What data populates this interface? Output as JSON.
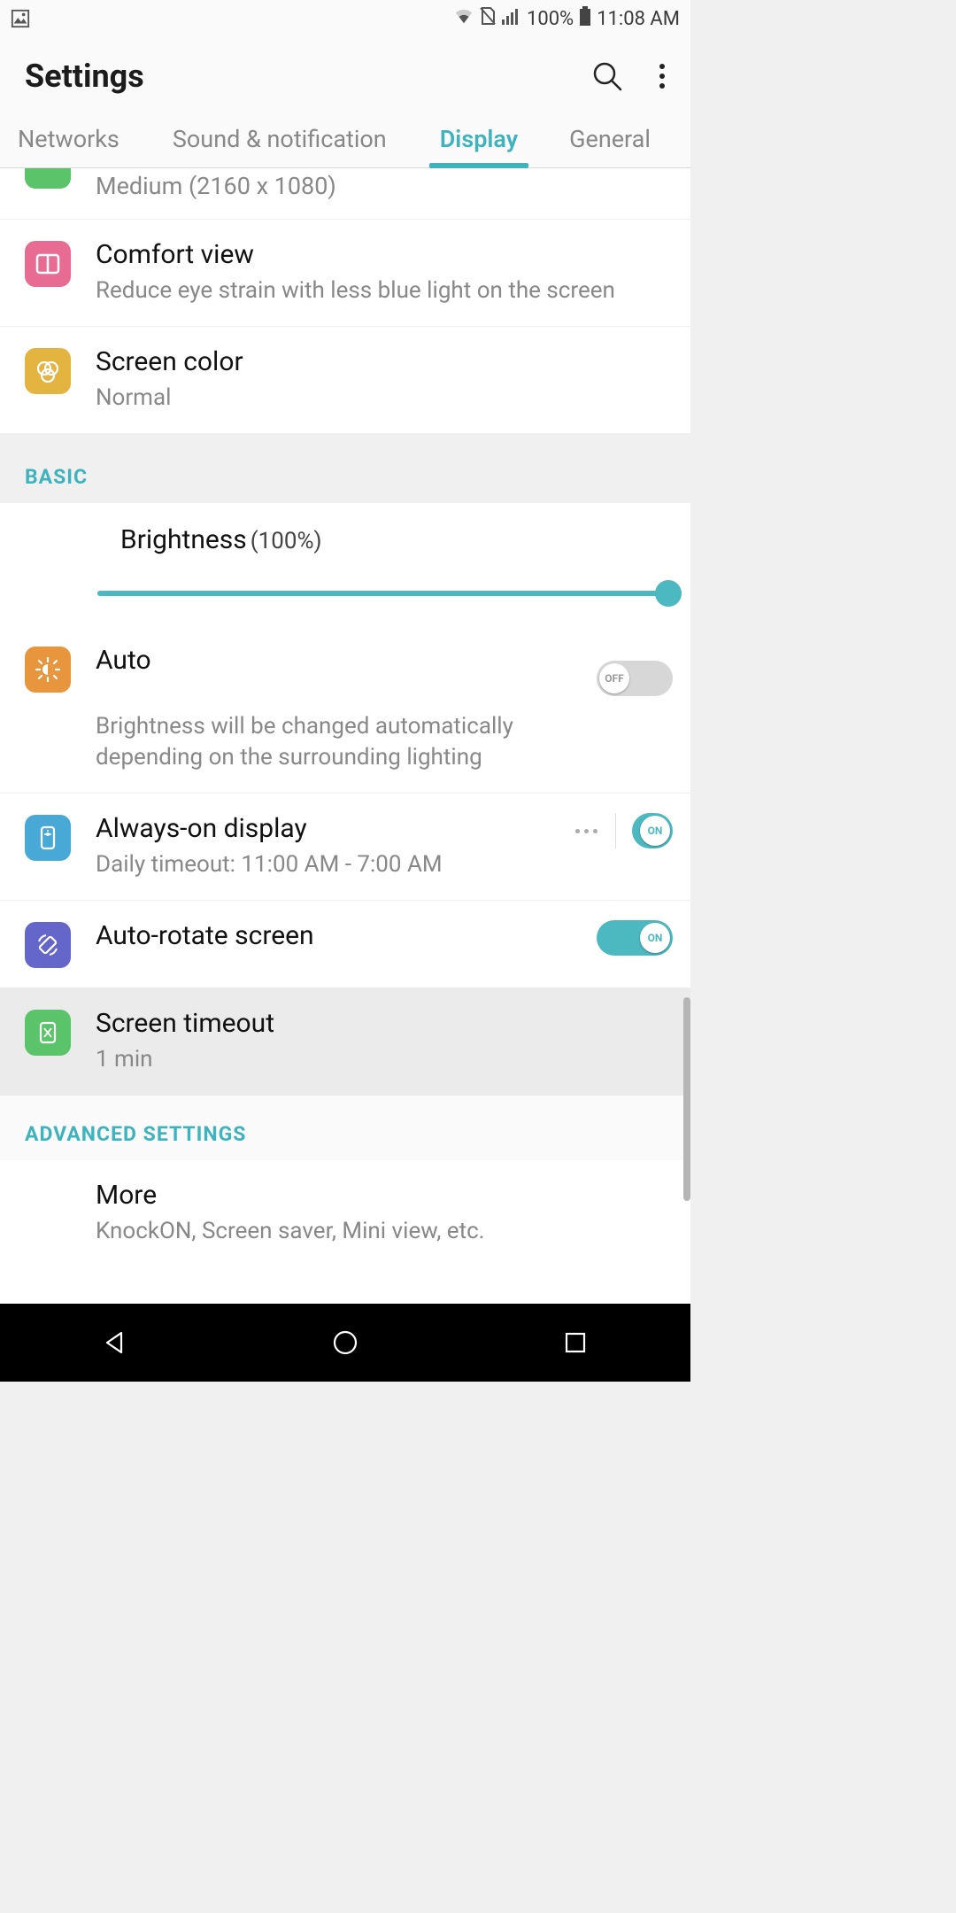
{
  "statusbar": {
    "battery_pct": "100%",
    "time": "11:08 AM"
  },
  "header": {
    "title": "Settings"
  },
  "tabs": {
    "networks": "Networks",
    "sound": "Sound & notification",
    "display": "Display",
    "general": "General"
  },
  "items": {
    "resolution_desc": "Medium (2160 x 1080)",
    "comfort": {
      "title": "Comfort view",
      "desc": "Reduce eye strain with less blue light on the screen"
    },
    "screen_color": {
      "title": "Screen color",
      "desc": "Normal"
    },
    "section_basic": "BASIC",
    "brightness": {
      "title": "Brightness",
      "pct": "(100%)"
    },
    "auto": {
      "title": "Auto",
      "desc": "Brightness will be changed automatically depending on the surrounding lighting",
      "toggle_label": "OFF"
    },
    "aod": {
      "title": "Always-on display",
      "desc": "Daily timeout: 11:00 AM - 7:00 AM",
      "toggle_label": "ON"
    },
    "rotate": {
      "title": "Auto-rotate screen",
      "toggle_label": "ON"
    },
    "timeout": {
      "title": "Screen timeout",
      "desc": "1 min"
    },
    "section_adv": "ADVANCED SETTINGS",
    "more": {
      "title": "More",
      "desc": "KnockON, Screen saver, Mini view, etc."
    }
  }
}
